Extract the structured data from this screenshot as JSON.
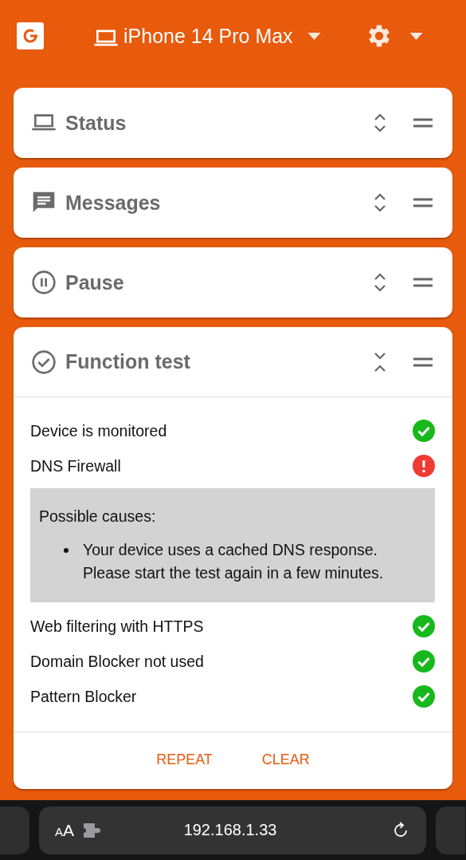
{
  "header": {
    "device": "iPhone 14 Pro Max"
  },
  "panels": [
    {
      "kind": "status",
      "title": "Status",
      "expanded": false
    },
    {
      "kind": "messages",
      "title": "Messages",
      "expanded": false
    },
    {
      "kind": "pause",
      "title": "Pause",
      "expanded": false
    },
    {
      "kind": "test",
      "title": "Function test",
      "expanded": true
    }
  ],
  "function_test": {
    "checks": [
      {
        "label": "Device is monitored",
        "passed": true
      },
      {
        "label": "DNS Firewall",
        "passed": false,
        "causes": {
          "title": "Possible causes:",
          "items": [
            "Your device uses a cached DNS response. Please start the test again in a few minutes."
          ]
        }
      },
      {
        "label": "Web filtering with HTTPS",
        "passed": true
      },
      {
        "label": "Domain Blocker not used",
        "passed": true
      },
      {
        "label": "Pattern Blocker",
        "passed": true
      }
    ],
    "actions": [
      "REPEAT",
      "CLEAR"
    ]
  },
  "browser_bar": {
    "text_size": "AA",
    "url": "192.168.1.33"
  }
}
